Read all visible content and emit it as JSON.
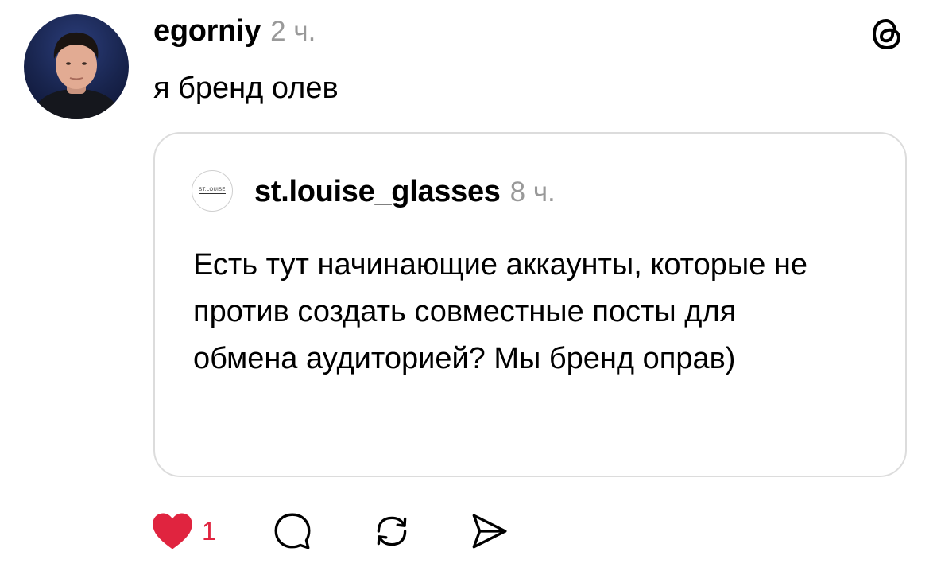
{
  "post": {
    "author": "egorniy",
    "time": "2 ч.",
    "text": "я бренд олев"
  },
  "quote": {
    "avatar_text": "ST.LOUISE",
    "author": "st.louise_glasses",
    "time": "8 ч.",
    "text": "Есть тут начинающие аккаунты, которые не против создать совместные посты для обмена аудиторией? Мы бренд оправ)"
  },
  "actions": {
    "like_count": "1",
    "like_color": "#e0243f"
  },
  "icons": {
    "avatar": "profile-photo",
    "logo": "threads-logo-icon",
    "like": "heart-icon",
    "comment": "comment-icon",
    "repost": "repost-icon",
    "share": "send-icon"
  }
}
